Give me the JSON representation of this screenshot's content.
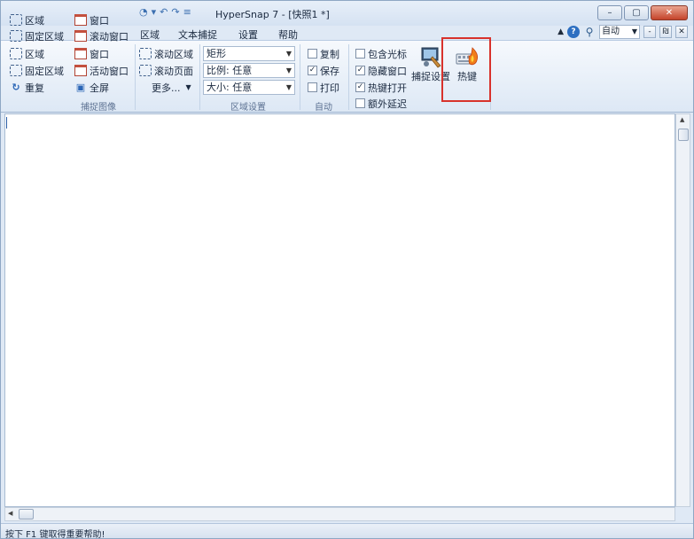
{
  "window": {
    "title": "HyperSnap 7 - [快照1 *]",
    "controls": {
      "minimize": "–",
      "maximize": "▢",
      "close": "✕"
    }
  },
  "tabs": [
    {
      "label": "区域",
      "active": true
    },
    {
      "label": "文本捕捉",
      "active": false
    },
    {
      "label": "设置",
      "active": false
    },
    {
      "label": "帮助",
      "active": false
    }
  ],
  "tabbar_right": {
    "zoom_value": "自动",
    "mini_buttons": [
      "-",
      "₪",
      "✕"
    ]
  },
  "ribbon": {
    "capture_group": {
      "label": "捕捉图像",
      "col1": [
        "区域",
        "固定区域",
        "区域",
        "固定区域",
        "重复"
      ],
      "col2": [
        "窗口",
        "滚动窗口",
        "窗口",
        "活动窗口",
        "全屏"
      ],
      "col3": [
        "滚动区域",
        "滚动页面",
        "更多..."
      ]
    },
    "region_settings": {
      "label": "区域设置",
      "shape": "矩形",
      "ratio": "比例: 任意",
      "size": "大小: 任意"
    },
    "auto_group": {
      "label": "自动",
      "items": [
        {
          "label": "复制",
          "checked": false
        },
        {
          "label": "保存",
          "checked": true
        },
        {
          "label": "打印",
          "checked": false
        }
      ]
    },
    "options_group": {
      "items": [
        {
          "label": "包含光标",
          "checked": false
        },
        {
          "label": "隐藏窗口",
          "checked": true
        },
        {
          "label": "热键打开",
          "checked": true
        },
        {
          "label": "额外延迟",
          "checked": false
        }
      ]
    },
    "capture_settings_label": "捕捉设置",
    "hotkey_label": "热键"
  },
  "status": {
    "text": "按下 F1 键取得重要帮助!"
  }
}
